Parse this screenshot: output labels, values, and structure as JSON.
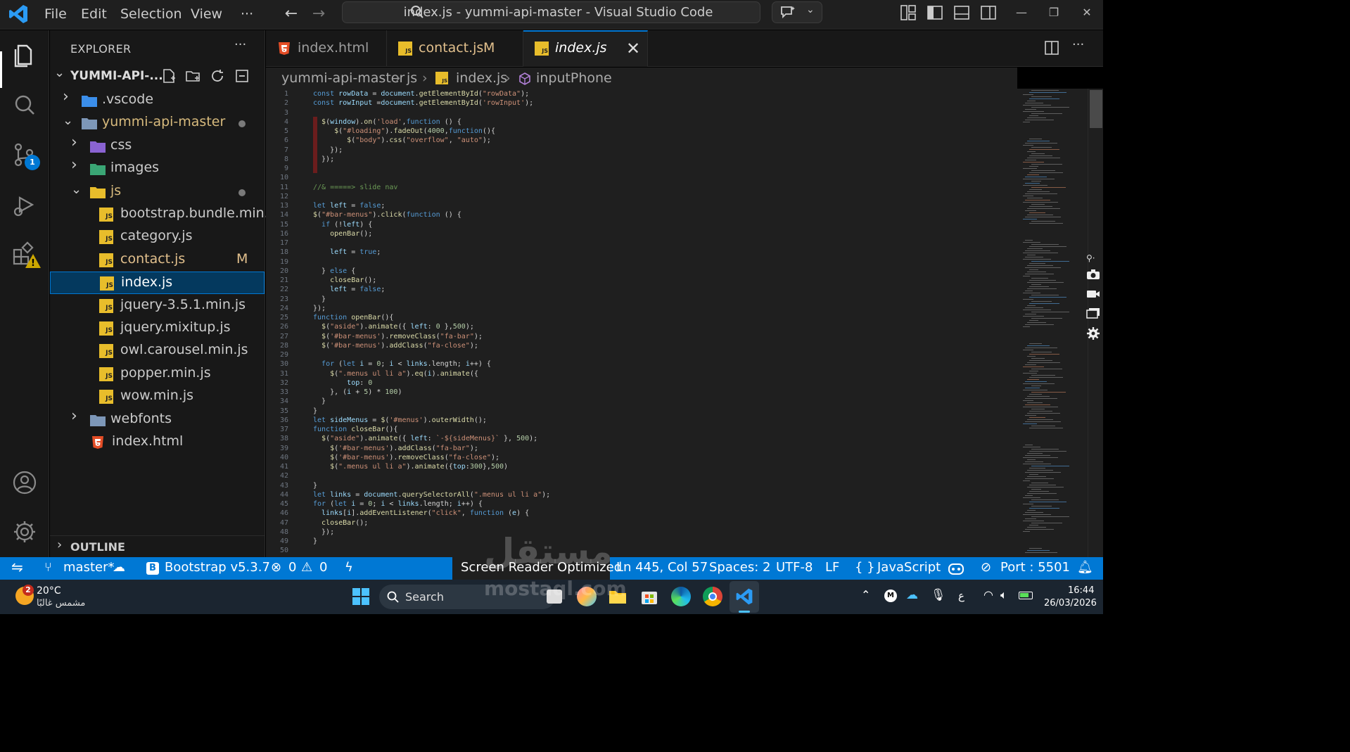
{
  "titlebar": {
    "menu": [
      "File",
      "Edit",
      "Selection",
      "View",
      "···"
    ],
    "command_center": "index.js - yummi-api-master - Visual Studio Code"
  },
  "activity_bar": {
    "scm_badge": "1"
  },
  "explorer": {
    "header": "EXPLORER",
    "more": "···",
    "project": "YUMMI-API-...",
    "tree": [
      {
        "label": ".vscode",
        "type": "folder",
        "expanded": false
      },
      {
        "label": "yummi-api-master",
        "type": "folder",
        "expanded": true
      },
      {
        "label": "css",
        "type": "folder",
        "expanded": false
      },
      {
        "label": "images",
        "type": "folder",
        "expanded": false
      },
      {
        "label": "js",
        "type": "folder",
        "expanded": true
      },
      {
        "label": "bootstrap.bundle.min.js",
        "type": "js"
      },
      {
        "label": "category.js",
        "type": "js"
      },
      {
        "label": "contact.js",
        "type": "js",
        "status": "M"
      },
      {
        "label": "index.js",
        "type": "js",
        "selected": true
      },
      {
        "label": "jquery-3.5.1.min.js",
        "type": "js"
      },
      {
        "label": "jquery.mixitup.js",
        "type": "js"
      },
      {
        "label": "owl.carousel.min.js",
        "type": "js"
      },
      {
        "label": "popper.min.js",
        "type": "js"
      },
      {
        "label": "wow.min.js",
        "type": "js"
      },
      {
        "label": "webfonts",
        "type": "folder",
        "expanded": false
      },
      {
        "label": "index.html",
        "type": "html"
      }
    ],
    "outline": "OUTLINE"
  },
  "tabs": [
    {
      "label": "index.html",
      "icon": "html-icon"
    },
    {
      "label": "contact.js",
      "status": "M",
      "icon": "js-icon"
    },
    {
      "label": "index.js",
      "icon": "js-icon",
      "active": true
    }
  ],
  "breadcrumb": [
    "yummi-api-master",
    "js",
    "index.js",
    "inputPhone"
  ],
  "code_lines": [
    "const rowData = document.getElementById(\"rowData\");",
    "const rowInput =document.getElementById('rowInput');",
    "",
    "  $(window).on('load',function () {",
    "     $(\"#loading\").fadeOut(4000,function(){",
    "        $(\"body\").css(\"overflow\", \"auto\");",
    "    });",
    "  });",
    "",
    "",
    "//& =====> slide nav",
    "",
    "let left = false;",
    "$(\"#bar-menus\").click(function () {",
    "  if (!left) {",
    "    openBar();",
    "",
    "    left = true;",
    "",
    "  } else {",
    "    closeBar();",
    "    left = false;",
    "  }",
    "});",
    "function openBar(){",
    "  $(\"aside\").animate({ left: 0 },500);",
    "  $('#bar-menus').removeClass(\"fa-bar\");",
    "  $('#bar-menus').addClass(\"fa-close\");",
    "",
    "  for (let i = 0; i < links.length; i++) {",
    "    $(\".menus ul li a\").eq(i).animate({",
    "        top: 0",
    "    }, (i + 5) * 100)",
    "  }",
    "}",
    "let sideMenus = $('#menus').outerWidth();",
    "function closeBar(){",
    "  $(\"aside\").animate({ left: `-${sideMenus}` }, 500);",
    "    $('#bar-menus').addClass(\"fa-bar\");",
    "    $('#bar-menus').removeClass(\"fa-close\");",
    "    $(\".menus ul li a\").animate({top:300},500)",
    "",
    "}",
    "let links = document.querySelectorAll(\".menus ul li a\");",
    "for (let i = 0; i < links.length; i++) {",
    "  links[i].addEventListener(\"click\", function (e) {",
    "  closeBar();",
    "  });",
    "}",
    ""
  ],
  "statusbar": {
    "branch": "master*",
    "bootstrap": "Bootstrap v5.3.7",
    "errors": "0",
    "warnings": "0",
    "screen_reader": "Screen Reader Optimized",
    "position": "Ln 445, Col 57",
    "spaces": "Spaces: 2",
    "encoding": "UTF-8",
    "eol": "LF",
    "language": "JavaScript",
    "port": "Port : 5501"
  },
  "taskbar": {
    "weather_temp": "20°C",
    "weather_desc": "مشمس غالبًا",
    "weather_badge": "2",
    "search": "Search",
    "lang": "ع",
    "time": "16:44",
    "date": "26/03/2026"
  },
  "watermark": {
    "arabic": "مستقل",
    "latin": "mostaql.com"
  },
  "colors": {
    "accent": "#0078d4",
    "js_icon": "#e8bd2b",
    "html_icon": "#e44d26",
    "modified": "#e2c08d"
  }
}
